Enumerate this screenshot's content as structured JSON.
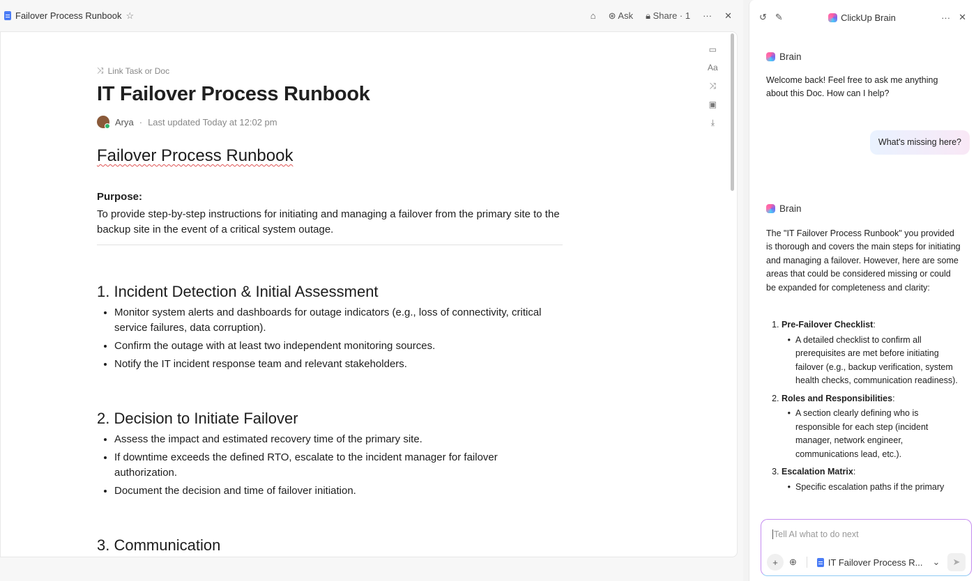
{
  "topbar": {
    "title": "Failover Process Runbook",
    "ask": "Ask",
    "share": "Share · 1"
  },
  "doc": {
    "link_label": "Link Task or Doc",
    "title": "IT Failover Process Runbook",
    "author": "Arya",
    "updated": "Last updated Today at 12:02 pm",
    "heading": "Failover Process Runbook",
    "purpose_label": "Purpose:",
    "purpose_text": "To provide step-by-step instructions for initiating and managing a failover from the primary site to the backup site in the event of a critical system outage.",
    "sections": [
      {
        "title": "1. Incident Detection & Initial Assessment",
        "items": [
          "Monitor system alerts and dashboards for outage indicators (e.g., loss of connectivity, critical service failures, data corruption).",
          "Confirm the outage with at least two independent monitoring sources.",
          "Notify the IT incident response team and relevant stakeholders."
        ]
      },
      {
        "title": "2. Decision to Initiate Failover",
        "items": [
          "Assess the impact and estimated recovery time of the primary site.",
          "If downtime exceeds the defined RTO, escalate to the incident manager for failover authorization.",
          "Document the decision and time of failover initiation."
        ]
      },
      {
        "title": "3. Communication",
        "items": []
      }
    ]
  },
  "brain": {
    "title": "ClickUp Brain",
    "sender": "Brain",
    "welcome": "Welcome back! Feel free to ask me anything about this Doc. How can I help?",
    "user_msg": "What's missing here?",
    "reply_intro": "The \"IT Failover Process Runbook\" you provided is thorough and covers the main steps for initiating and managing a failover. However, here are some areas that could be considered missing or could be expanded for completeness and clarity:",
    "points": [
      {
        "title": "Pre-Failover Checklist",
        "detail": "A detailed checklist to confirm all prerequisites are met before initiating failover (e.g., backup verification, system health checks, communication readiness)."
      },
      {
        "title": "Roles and Responsibilities",
        "detail": "A section clearly defining who is responsible for each step (incident manager, network engineer, communications lead, etc.)."
      },
      {
        "title": "Escalation Matrix",
        "detail": "Specific escalation paths if the primary"
      }
    ],
    "input_placeholder": "Tell AI what to do next",
    "context_doc": "IT Failover Process R..."
  }
}
